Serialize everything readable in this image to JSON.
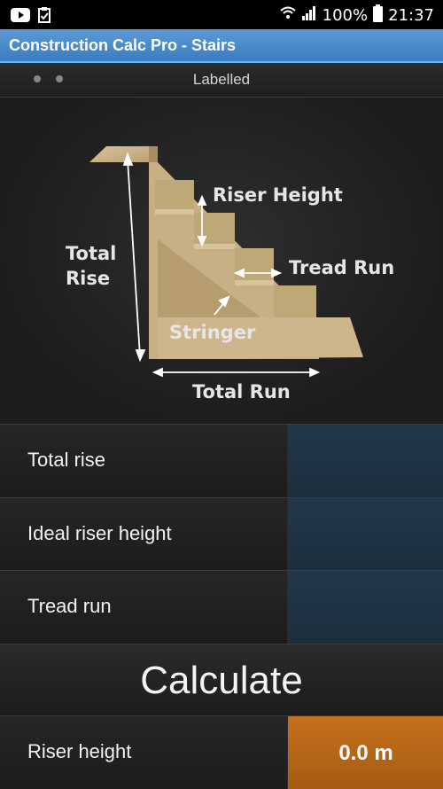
{
  "status_bar": {
    "battery": "100%",
    "time": "21:37"
  },
  "app": {
    "title": "Construction Calc Pro - Stairs"
  },
  "pager": {
    "label": "Labelled"
  },
  "diagram": {
    "riser_height": "Riser Height",
    "tread_run": "Tread Run",
    "total_rise_line1": "Total",
    "total_rise_line2": "Rise",
    "stringer": "Stringer",
    "total_run": "Total Run"
  },
  "inputs": [
    {
      "label": "Total rise",
      "value": ""
    },
    {
      "label": "Ideal riser height",
      "value": ""
    },
    {
      "label": "Tread run",
      "value": ""
    }
  ],
  "calculate_label": "Calculate",
  "result": {
    "label": "Riser height",
    "value": "0.0 m"
  },
  "colors": {
    "title_bar": "#4a8bcc",
    "input_field": "#1e3345",
    "result_field": "#b8661a"
  }
}
